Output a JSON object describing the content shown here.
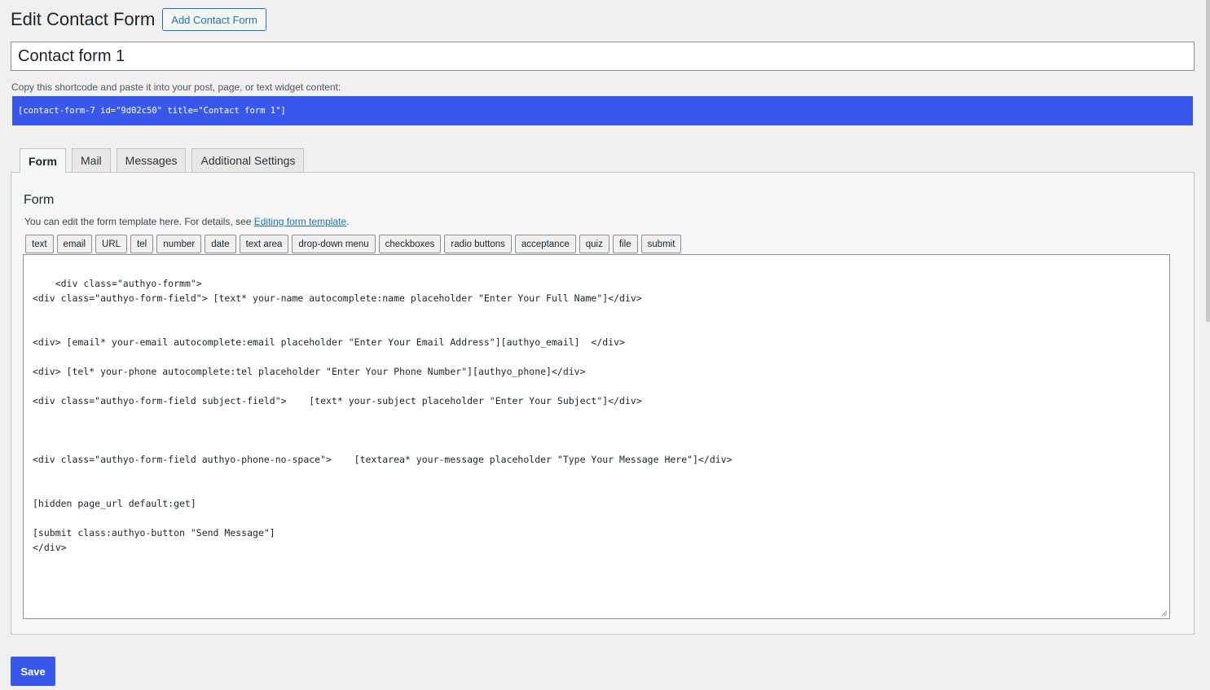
{
  "header": {
    "title": "Edit Contact Form",
    "add_button": "Add Contact Form"
  },
  "form_title_value": "Contact form 1",
  "shortcode": {
    "label": "Copy this shortcode and paste it into your post, page, or text widget content:",
    "value": "[contact-form-7 id=\"9d02c50\" title=\"Contact form 1\"]"
  },
  "tabs": [
    {
      "label": "Form",
      "active": true
    },
    {
      "label": "Mail",
      "active": false
    },
    {
      "label": "Messages",
      "active": false
    },
    {
      "label": "Additional Settings",
      "active": false
    }
  ],
  "panel": {
    "title": "Form",
    "desc_prefix": "You can edit the form template here. For details, see ",
    "desc_link": "Editing form template",
    "desc_suffix": ".",
    "tag_buttons": [
      "text",
      "email",
      "URL",
      "tel",
      "number",
      "date",
      "text area",
      "drop-down menu",
      "checkboxes",
      "radio buttons",
      "acceptance",
      "quiz",
      "file",
      "submit"
    ],
    "template": "<div class=\"authyo-formm\">\n<div class=\"authyo-form-field\"> [text* your-name autocomplete:name placeholder \"Enter Your Full Name\"]</div>\n\n\n<div> [email* your-email autocomplete:email placeholder \"Enter Your Email Address\"][authyo_email]  </div>\n\n<div> [tel* your-phone autocomplete:tel placeholder \"Enter Your Phone Number\"][authyo_phone]</div>\n\n<div class=\"authyo-form-field subject-field\">    [text* your-subject placeholder \"Enter Your Subject\"]</div>\n\n\n\n<div class=\"authyo-form-field authyo-phone-no-space\">    [textarea* your-message placeholder \"Type Your Message Here\"]</div>\n\n\n[hidden page_url default:get]\n\n[submit class:authyo-button \"Send Message\"]\n</div>"
  },
  "save_button": "Save",
  "colors": {
    "accent": "#3858e9",
    "link": "#2271b1",
    "background": "#f0f0f1"
  }
}
